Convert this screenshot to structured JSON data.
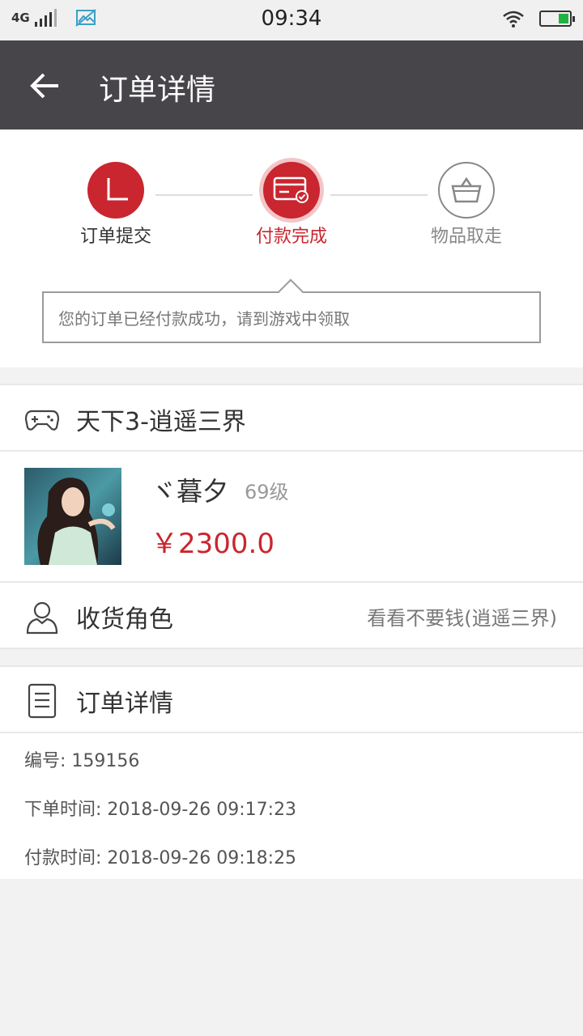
{
  "status_bar": {
    "network": "4G",
    "time": "09:34"
  },
  "header": {
    "title": "订单详情"
  },
  "progress": {
    "steps": [
      {
        "label": "订单提交",
        "state": "done"
      },
      {
        "label": "付款完成",
        "state": "current"
      },
      {
        "label": "物品取走",
        "state": "pending"
      }
    ],
    "notice": "您的订单已经付款成功，请到游戏中领取"
  },
  "game": {
    "name": "天下3-逍遥三界"
  },
  "item": {
    "character_name": "ヾ暮夕",
    "level": "69级",
    "price": "￥2300.0"
  },
  "receiver": {
    "label": "收货角色",
    "value": "看看不要钱(逍遥三界)"
  },
  "order_details": {
    "title": "订单详情",
    "number": "编号: 159156",
    "order_time": "下单时间: 2018-09-26 09:17:23",
    "pay_time": "付款时间: 2018-09-26 09:18:25"
  },
  "colors": {
    "accent": "#c9262f",
    "titlebar": "#47454a"
  }
}
